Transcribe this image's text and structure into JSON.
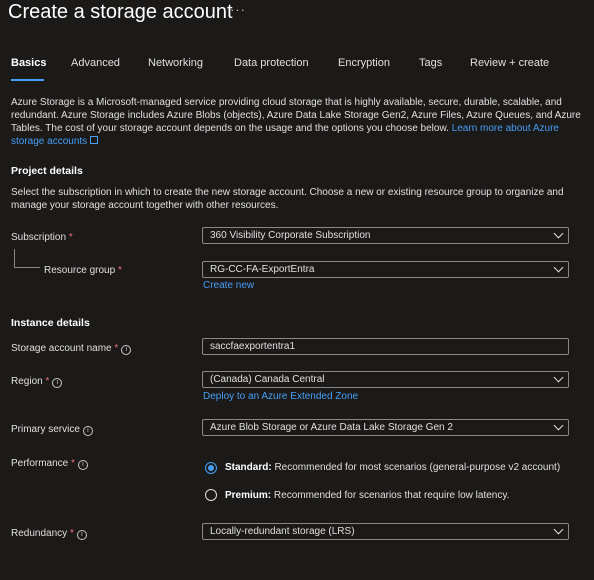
{
  "header": {
    "title": "Create a storage account",
    "more": "···"
  },
  "tabs": [
    {
      "label": "Basics"
    },
    {
      "label": "Advanced"
    },
    {
      "label": "Networking"
    },
    {
      "label": "Data protection"
    },
    {
      "label": "Encryption"
    },
    {
      "label": "Tags"
    },
    {
      "label": "Review + create"
    }
  ],
  "intro": {
    "line1": "Azure Storage is a Microsoft-managed service providing cloud storage that is highly available, secure, durable, scalable, and",
    "line2": "redundant. Azure Storage includes Azure Blobs (objects), Azure Data Lake Storage Gen2, Azure Files, Azure Queues, and Azure",
    "line3": "Tables. The cost of your storage account depends on the usage and the options you choose below.",
    "link1": "Learn more about Azure",
    "link2": "storage accounts"
  },
  "project": {
    "heading": "Project details",
    "desc1": "Select the subscription in which to create the new storage account. Choose a new or existing resource group to organize and",
    "desc2": "manage your storage account together with other resources.",
    "subscription_label": "Subscription",
    "subscription_value": "360 Visibility Corporate Subscription",
    "rg_label": "Resource group",
    "rg_value": "RG-CC-FA-ExportEntra",
    "create_new": "Create new"
  },
  "instance": {
    "heading": "Instance details",
    "name_label": "Storage account name",
    "name_value": "saccfaexportentra1",
    "region_label": "Region",
    "region_value": "(Canada) Canada Central",
    "edge_zone_link": "Deploy to an Azure Extended Zone",
    "primary_label": "Primary service",
    "primary_value": "Azure Blob Storage or Azure Data Lake Storage Gen 2",
    "performance_label": "Performance",
    "perf_standard_title": "Standard:",
    "perf_standard_desc": "Recommended for most scenarios (general-purpose v2 account)",
    "perf_premium_title": "Premium:",
    "perf_premium_desc": "Recommended for scenarios that require low latency.",
    "redundancy_label": "Redundancy",
    "redundancy_value": "Locally-redundant storage (LRS)"
  },
  "common": {
    "required_mark": "*",
    "info_glyph": "i"
  },
  "colors": {
    "background": "#1b1a19",
    "accent": "#479ef5",
    "required": "#f1707b"
  }
}
